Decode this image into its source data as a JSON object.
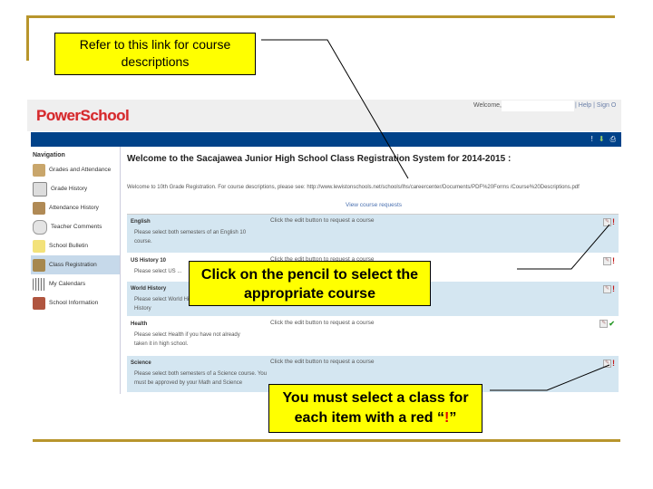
{
  "callouts": {
    "link": "Refer to this link for course descriptions",
    "pencil": "Click on the pencil to select the appropriate course",
    "red_prefix": "You must select a class for each item with a red “",
    "red_mark": "!",
    "red_suffix": "”"
  },
  "app": {
    "logo": "PowerSchool",
    "welcome_label": "Welcome,",
    "top_links": "| Help | Sign O",
    "nav_icons": [
      "alert-icon",
      "download-icon",
      "print-icon"
    ]
  },
  "sidebar": {
    "title": "Navigation",
    "items": [
      {
        "label": "Grades and Attendance",
        "icon": "grades-icon",
        "active": false
      },
      {
        "label": "Grade History",
        "icon": "grade-history-icon",
        "active": false
      },
      {
        "label": "Attendance History",
        "icon": "attendance-icon",
        "active": false
      },
      {
        "label": "Teacher Comments",
        "icon": "comments-icon",
        "active": false
      },
      {
        "label": "School Bulletin",
        "icon": "bulletin-icon",
        "active": false
      },
      {
        "label": "Class Registration",
        "icon": "registration-icon",
        "active": true
      },
      {
        "label": "My Calendars",
        "icon": "calendar-icon",
        "active": false
      },
      {
        "label": "School Information",
        "icon": "school-icon",
        "active": false
      }
    ]
  },
  "main": {
    "title": "Welcome to the Sacajawea Junior High School Class Registration System for 2014-2015 :",
    "intro": "Welcome to 10th Grade Registration. For course descriptions, please see: http://www.lewistonschools.net/schools/lhs/careercenter/Documents/PDF%20Forms /Course%20Descriptions.pdf",
    "view_requests": "View course requests",
    "rows": [
      {
        "name": "English",
        "desc": "Please select both semesters of an English 10 course.",
        "click": "Click the edit button to request a course",
        "status": "required"
      },
      {
        "name": "US History 10",
        "desc": "Please select US ...",
        "click": "Click the edit button to request a course",
        "status": "required"
      },
      {
        "name": "World History",
        "desc": "Please select World History or AP European History",
        "click": "Click the edit button to request a course",
        "status": "required"
      },
      {
        "name": "Health",
        "desc": "Please select Health if you have not already taken it in high school.",
        "click": "Click the edit button to request a course",
        "status": "done"
      },
      {
        "name": "Science",
        "desc": "Please select both semesters of a Science course. You must be approved by your Math and Science",
        "click": "Click the edit button to request a course",
        "status": "required"
      }
    ]
  }
}
